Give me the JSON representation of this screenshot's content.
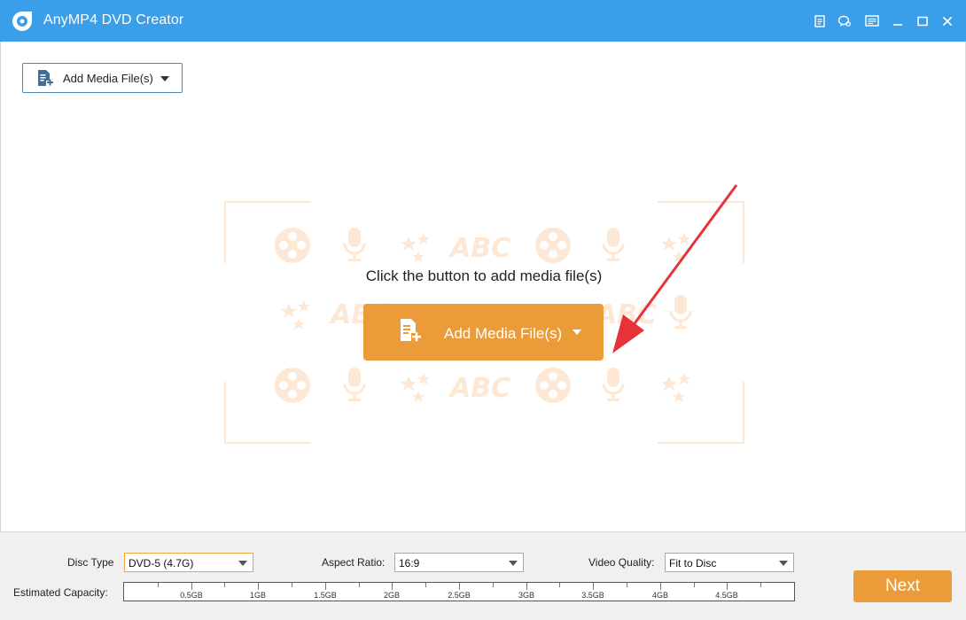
{
  "app": {
    "title": "AnyMP4 DVD Creator",
    "accent_color": "#3a9ee8",
    "action_color": "#eb9c38"
  },
  "titlebar": {
    "buttons": [
      {
        "name": "register-icon"
      },
      {
        "name": "feedback-icon"
      },
      {
        "name": "menu-icon"
      },
      {
        "name": "minimize-icon"
      },
      {
        "name": "maximize-icon"
      },
      {
        "name": "close-icon"
      }
    ]
  },
  "toolbar": {
    "add_media_label": "Add Media File(s)"
  },
  "dropzone": {
    "prompt": "Click the button to add media file(s)",
    "button_label": "Add Media File(s)",
    "pattern_text": "ABC"
  },
  "settings": {
    "disc_type": {
      "label": "Disc Type",
      "value": "DVD-5 (4.7G)"
    },
    "aspect_ratio": {
      "label": "Aspect Ratio:",
      "value": "16:9"
    },
    "video_quality": {
      "label": "Video Quality:",
      "value": "Fit to Disc"
    }
  },
  "capacity": {
    "label": "Estimated Capacity:",
    "ticks": [
      "0.5GB",
      "1GB",
      "1.5GB",
      "2GB",
      "2.5GB",
      "3GB",
      "3.5GB",
      "4GB",
      "4.5GB"
    ],
    "used_fraction": 0
  },
  "next_label": "Next"
}
